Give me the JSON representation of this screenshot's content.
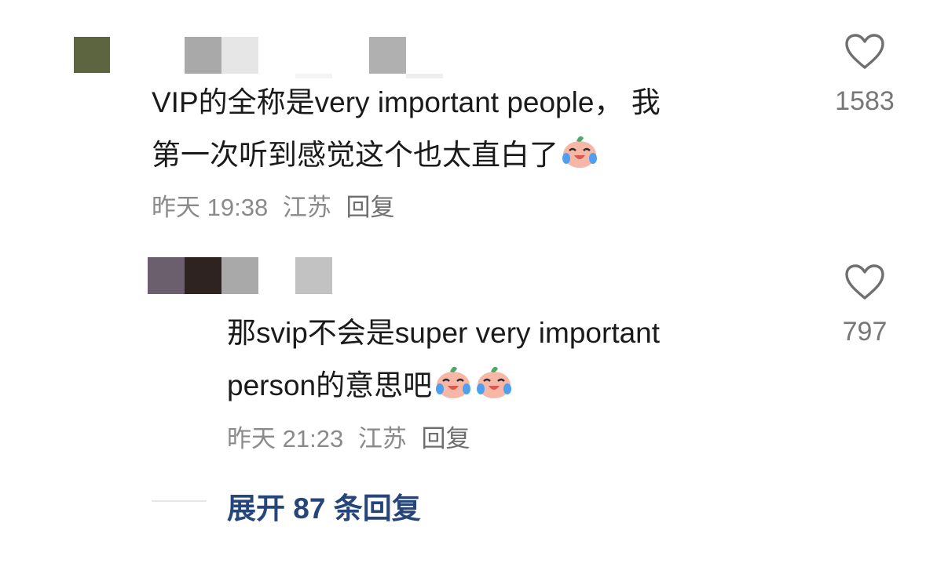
{
  "comments": [
    {
      "text_line1": "VIP的全称是very important  people， 我",
      "text_line2": "第一次听到感觉这个也太直白了",
      "emoji_count": 1,
      "time": "昨天 19:38",
      "location": "江苏",
      "reply_label": "回复",
      "like_count": "1583",
      "like_icon": "heart-outline-icon",
      "avatar_colors": [
        "#5c6440",
        "#a9a9a9",
        "#e6e6e6",
        "#f6f6f6",
        "#a9a9a9",
        "#ececec"
      ]
    },
    {
      "text_line1": "那svip不会是super very important",
      "text_line2": "person的意思吧",
      "emoji_count": 2,
      "time": "昨天 21:23",
      "location": "江苏",
      "reply_label": "回复",
      "like_count": "797",
      "like_icon": "heart-outline-icon",
      "avatar_colors": [
        "#6b5f6e",
        "#2e2320",
        "#a9a9a9",
        "#c2c2c2"
      ]
    }
  ],
  "expand_replies": {
    "label": "展开 87 条回复"
  },
  "colors": {
    "text": "#1a1a1a",
    "meta": "#8a8a8a",
    "link": "#26457a",
    "like_count": "#777777"
  }
}
